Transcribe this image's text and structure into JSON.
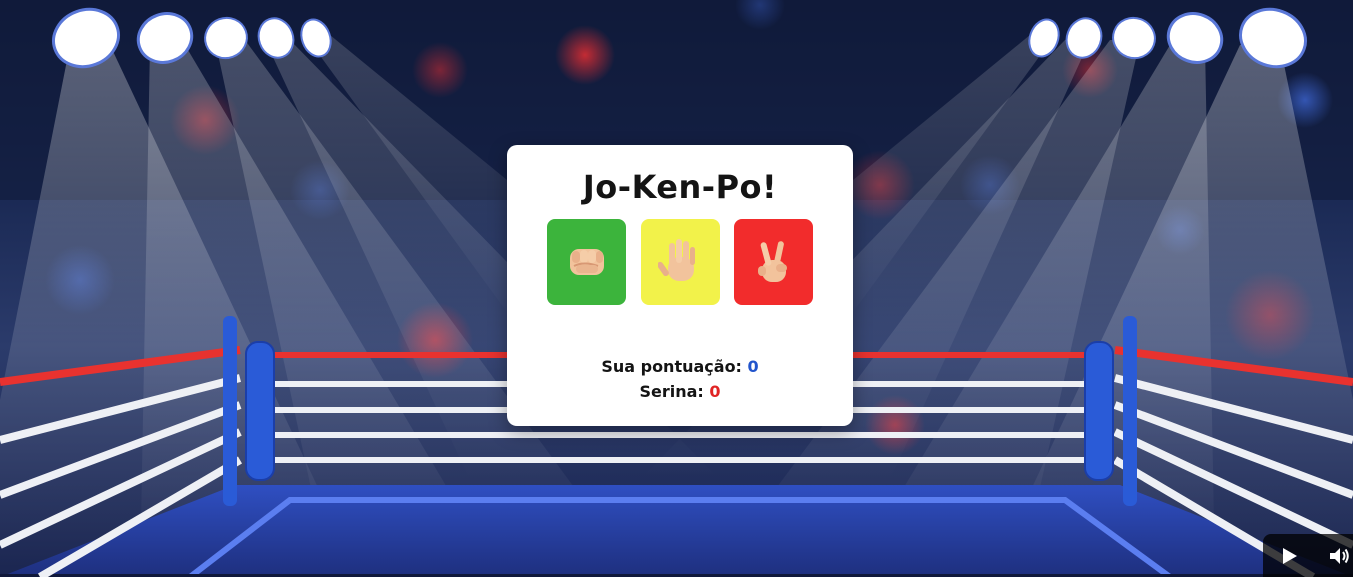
{
  "game": {
    "title": "Jo-Ken-Po!",
    "choices": [
      {
        "id": "rock",
        "icon": "fist-icon",
        "color": "#3cb43c"
      },
      {
        "id": "paper",
        "icon": "open-hand-icon",
        "color": "#f2f24a"
      },
      {
        "id": "scissors",
        "icon": "victory-hand-icon",
        "color": "#f22c2c"
      }
    ]
  },
  "score": {
    "player_label": "Sua pontuação:",
    "player_value": "0",
    "cpu_label": "Serina:",
    "cpu_value": "0",
    "player_color": "#2255cc",
    "cpu_color": "#e02424"
  },
  "media": {
    "play_icon": "play-icon",
    "volume_icon": "volume-icon"
  },
  "colors": {
    "ring_ropes_red": "#e8322f",
    "ring_ropes_white": "#eef0f5",
    "ring_posts": "#2a5bd7",
    "ring_floor": "#2c49b8"
  }
}
